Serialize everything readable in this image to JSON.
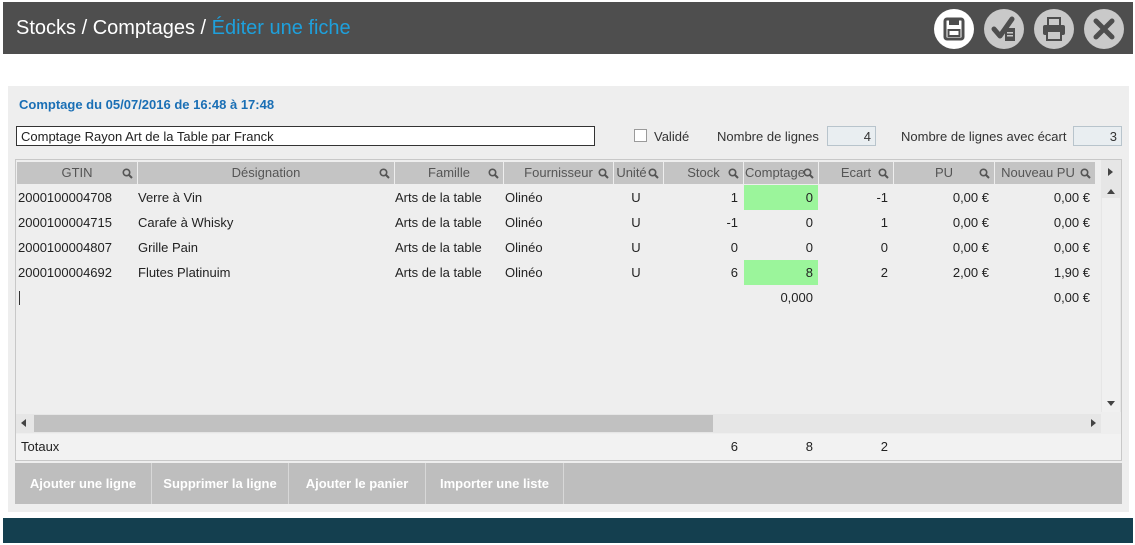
{
  "header": {
    "breadcrumb_stocks": "Stocks",
    "separator": " / ",
    "breadcrumb_comptages": "Comptages",
    "current_page": "Éditer une fiche",
    "actions": [
      {
        "name": "save",
        "icon": "floppy-disk-icon"
      },
      {
        "name": "validate",
        "icon": "check-document-icon"
      },
      {
        "name": "print",
        "icon": "printer-icon"
      },
      {
        "name": "close",
        "icon": "close-icon"
      }
    ]
  },
  "form": {
    "heading": "Comptage du 05/07/2016 de 16:48 à 17:48",
    "name_value": "Comptage Rayon Art de la Table par Franck",
    "validated_label": "Validé",
    "validated_checked": false,
    "lines_label": "Nombre de lignes",
    "lines_value": "4",
    "lines_gap_label": "Nombre de lignes avec écart",
    "lines_gap_value": "3"
  },
  "table": {
    "columns": [
      "GTIN",
      "Désignation",
      "Famille",
      "Fournisseur",
      "Unité",
      "Stock",
      "Comptage",
      "Ecart",
      "PU",
      "Nouveau PU"
    ],
    "rows": [
      {
        "gtin": "2000100004708",
        "designation": "Verre à Vin",
        "famille": "Arts de la table",
        "fournisseur": "Olinéo",
        "unite": "U",
        "stock": "1",
        "comptage": "0",
        "ecart": "-1",
        "pu": "0,00 €",
        "nouveau_pu": "0,00 €",
        "highlight": true
      },
      {
        "gtin": "2000100004715",
        "designation": "Carafe à Whisky",
        "famille": "Arts de la table",
        "fournisseur": "Olinéo",
        "unite": "U",
        "stock": "-1",
        "comptage": "0",
        "ecart": "1",
        "pu": "0,00 €",
        "nouveau_pu": "0,00 €",
        "highlight": false
      },
      {
        "gtin": "2000100004807",
        "designation": "Grille Pain",
        "famille": "Arts de la table",
        "fournisseur": "Olinéo",
        "unite": "U",
        "stock": "0",
        "comptage": "0",
        "ecart": "0",
        "pu": "0,00 €",
        "nouveau_pu": "0,00 €",
        "highlight": false
      },
      {
        "gtin": "2000100004692",
        "designation": "Flutes Platinuim",
        "famille": "Arts de la table",
        "fournisseur": "Olinéo",
        "unite": "U",
        "stock": "6",
        "comptage": "8",
        "ecart": "2",
        "pu": "2,00 €",
        "nouveau_pu": "1,90 €",
        "highlight": true
      }
    ],
    "new_row": {
      "comptage": "0,000",
      "nouveau_pu": "0,00 €"
    },
    "totals": {
      "label": "Totaux",
      "stock": "6",
      "comptage": "8",
      "ecart": "2"
    },
    "highlight_color": "#9bf59b"
  },
  "buttons": {
    "add_line": "Ajouter une ligne",
    "delete_line": "Supprimer la ligne",
    "add_cart": "Ajouter le panier",
    "import_list": "Importer une liste"
  },
  "colors": {
    "titlebar": "#4e4e4e",
    "accent": "#1ea0dc",
    "heading": "#1a6fb5",
    "footer": "#143f4f"
  }
}
